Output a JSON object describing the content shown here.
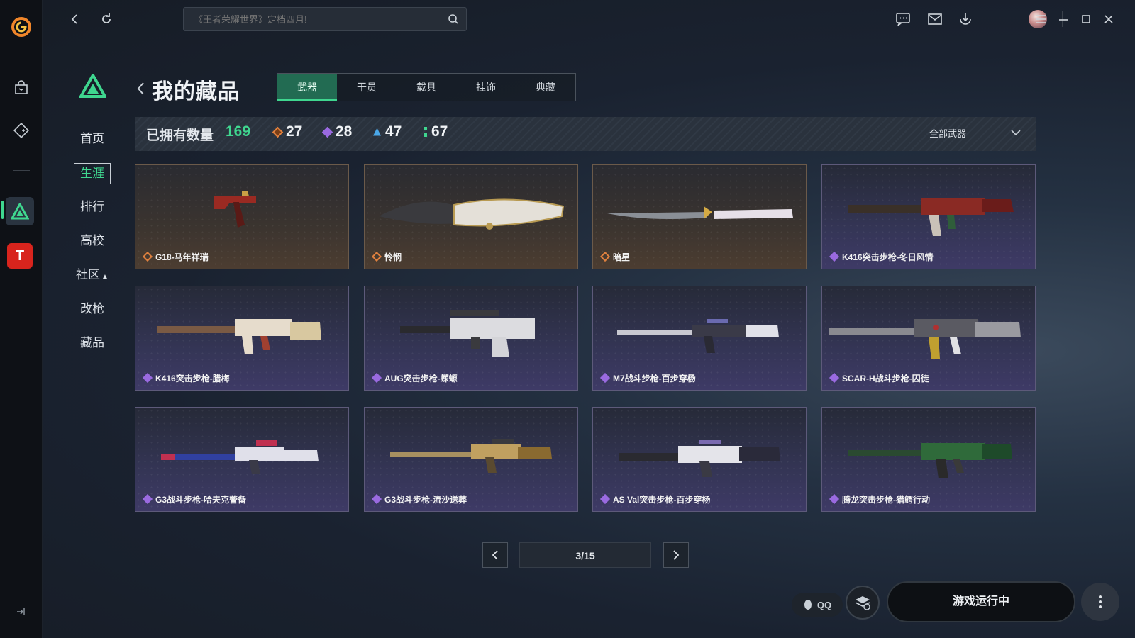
{
  "search": {
    "placeholder": "《王者荣耀世界》定档四月!"
  },
  "sidenav": [
    "首页",
    "生涯",
    "排行",
    "高校",
    "社区",
    "改枪",
    "藏品"
  ],
  "page": {
    "title": "我的藏品"
  },
  "tabs": [
    "武器",
    "干员",
    "载具",
    "挂饰",
    "典藏"
  ],
  "stats": {
    "label": "已拥有数量",
    "total": "169",
    "gold": "27",
    "purple": "28",
    "blue": "47",
    "green": "67",
    "filter": "全部武器"
  },
  "rarity_colors": {
    "gold": "#e0813f",
    "purple": "#9a6ae0",
    "blue": "#4aa7e8",
    "green": "#3fd68f"
  },
  "cards": [
    {
      "name": "G18-马年祥瑞",
      "rarity": "gold"
    },
    {
      "name": "怜悯",
      "rarity": "gold"
    },
    {
      "name": "暗星",
      "rarity": "gold"
    },
    {
      "name": "K416突击步枪-冬日风情",
      "rarity": "purple"
    },
    {
      "name": "K416突击步枪-腊梅",
      "rarity": "purple"
    },
    {
      "name": "AUG突击步枪-蝾螈",
      "rarity": "purple"
    },
    {
      "name": "M7战斗步枪-百步穿杨",
      "rarity": "purple"
    },
    {
      "name": "SCAR-H战斗步枪-囚徒",
      "rarity": "purple"
    },
    {
      "name": "G3战斗步枪-哈夫克警备",
      "rarity": "purple"
    },
    {
      "name": "G3战斗步枪-流沙送葬",
      "rarity": "purple"
    },
    {
      "name": "AS Val突击步枪-百步穿杨",
      "rarity": "purple"
    },
    {
      "name": "腾龙突击步枪-猎鳄行动",
      "rarity": "purple"
    }
  ],
  "pagination": {
    "current": "3/15"
  },
  "bottom": {
    "qq_label": "QQ",
    "launch_label": "游戏运行中"
  }
}
